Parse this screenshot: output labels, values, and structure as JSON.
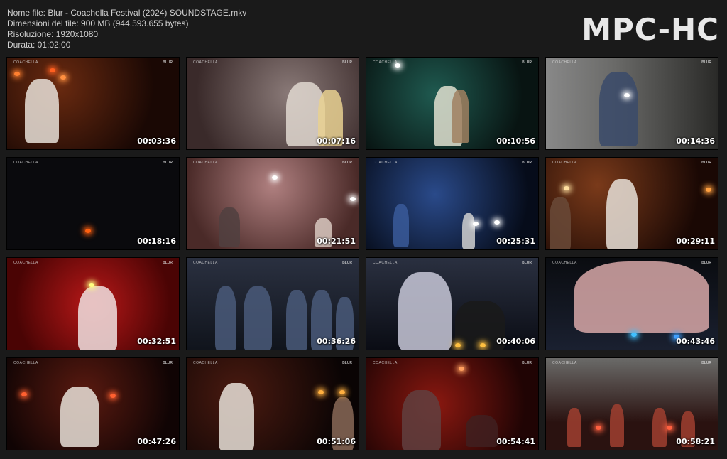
{
  "header": {
    "file_name": "Nome file: Blur - Coachella Festival (2024) SOUNDSTAGE.mkv",
    "file_size": "Dimensioni del file: 900 MB (944.593.655 bytes)",
    "resolution": "Risoluzione: 1920x1080",
    "duration": "Durata: 01:02:00",
    "logo": "MPC-HC"
  },
  "thumbnails": [
    {
      "time": "00:03:36",
      "tint": "#2a1208"
    },
    {
      "time": "00:07:16",
      "tint": "#5a4a48"
    },
    {
      "time": "00:10:56",
      "tint": "#0f2a28"
    },
    {
      "time": "00:14:36",
      "tint": "#4a4a48"
    },
    {
      "time": "00:18:16",
      "tint": "#0a0a0d"
    },
    {
      "time": "00:21:51",
      "tint": "#6a4a48"
    },
    {
      "time": "00:25:31",
      "tint": "#0e1d3a"
    },
    {
      "time": "00:29:11",
      "tint": "#3a160e"
    },
    {
      "time": "00:32:51",
      "tint": "#6a1010"
    },
    {
      "time": "00:36:26",
      "tint": "#1a2230"
    },
    {
      "time": "00:40:06",
      "tint": "#161a24"
    },
    {
      "time": "00:43:46",
      "tint": "#101418"
    },
    {
      "time": "00:47:26",
      "tint": "#2a0806"
    },
    {
      "time": "00:51:06",
      "tint": "#1a0806"
    },
    {
      "time": "00:54:41",
      "tint": "#3a0a08"
    },
    {
      "time": "00:58:21",
      "tint": "#2a1a16"
    }
  ],
  "watermark_left": "COACHELLA",
  "watermark_right": "BLUR"
}
